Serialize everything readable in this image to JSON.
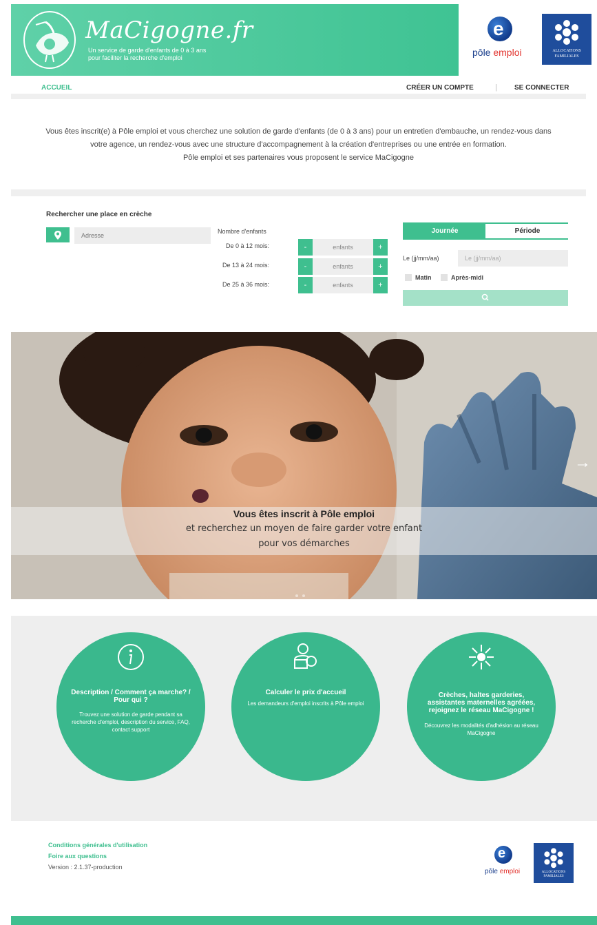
{
  "brand": {
    "title": "MaCigogne.fr",
    "subtitle_line1": "Un service de garde d'enfants de 0 à 3 ans",
    "subtitle_line2": "pour faciliter la recherche d'emploi",
    "accent_color": "#3fbf8f"
  },
  "partners": {
    "pole_emploi_prefix": "pôle ",
    "pole_emploi_suffix": "emploi",
    "caf_line1": "ALLOCATIONS",
    "caf_line2": "FAMILIALES"
  },
  "nav": {
    "home": "ACCUEIL",
    "create_account": "CRÉER UN COMPTE",
    "separator": "|",
    "login": "SE CONNECTER"
  },
  "intro": {
    "line1": "Vous êtes inscrit(e) à Pôle emploi et vous cherchez une solution de garde d'enfants (de 0 à 3 ans) pour un entretien d'embauche, un rendez-vous dans",
    "line2": "votre agence, un rendez-vous avec une structure d'accompagnement à la création d'entreprises ou une entrée en formation.",
    "line3": "Pôle emploi et ses partenaires vous proposent le service MaCigogne"
  },
  "search": {
    "title": "Rechercher une place en crèche",
    "address_placeholder": "Adresse",
    "kids_title": "Nombre d'enfants",
    "age_groups": [
      {
        "label": "De 0 à 12 mois:",
        "value": "enfants"
      },
      {
        "label": "De 13 à 24 mois:",
        "value": "enfants"
      },
      {
        "label": "De 25 à 36 mois:",
        "value": "enfants"
      }
    ],
    "minus": "-",
    "plus": "+",
    "tab_day": "Journée",
    "tab_period": "Période",
    "date_label": "Le (jj/mm/aa)",
    "date_placeholder": "Le (jj/mm/aa)",
    "morning": "Matin",
    "afternoon": "Après-midi"
  },
  "hero": {
    "line1": "Vous êtes inscrit à Pôle emploi",
    "line2": "et recherchez un moyen de faire garder votre enfant",
    "line3": "pour vos démarches",
    "arrow": "→"
  },
  "cards": [
    {
      "icon": "info-icon",
      "title": "Description / Comment ça marche? / Pour qui ?",
      "text": "Trouvez une solution de garde pendant sa recherche d'emploi, description du service, FAQ, contact support"
    },
    {
      "icon": "price-user-icon",
      "title": "Calculer le prix d'accueil",
      "text": "Les demandeurs d'emploi inscrits à Pôle emploi"
    },
    {
      "icon": "network-icon",
      "title": "Crèches, haltes garderies, assistantes maternelles agréées, rejoignez le réseau MaCigogne !",
      "text": "Découvrez les modalités d'adhésion au réseau MaCigogne"
    }
  ],
  "footer": {
    "cgu": "Conditions générales d'utilisation",
    "faq": "Foire aux questions",
    "version": "Version : 2.1.37-production"
  }
}
